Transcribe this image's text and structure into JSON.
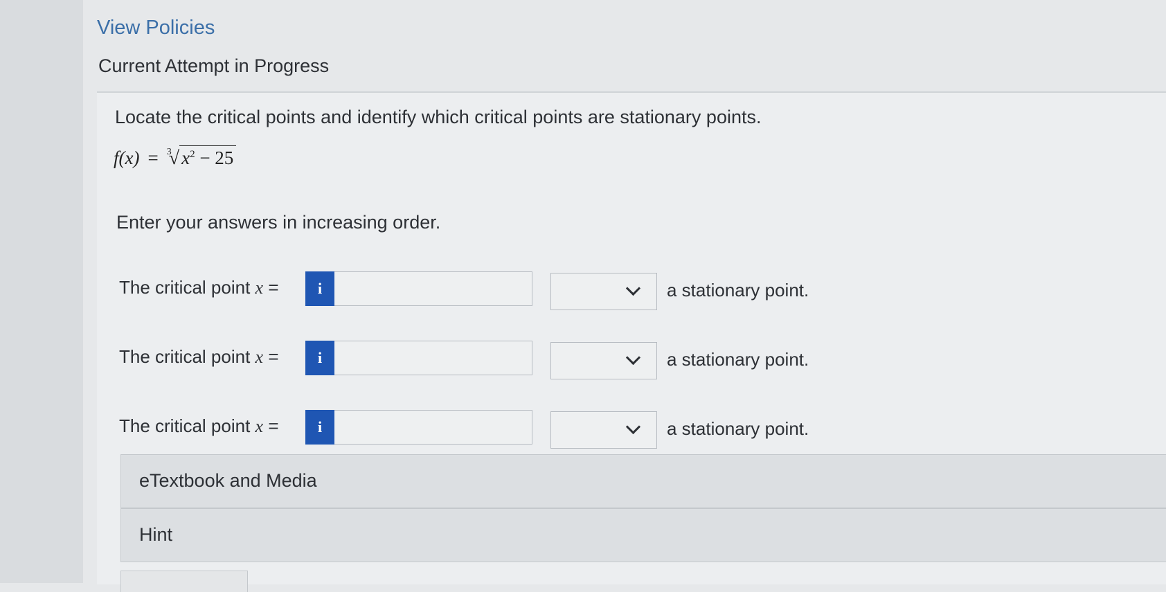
{
  "header": {
    "view_policies": "View Policies",
    "attempt_title": "Current Attempt in Progress"
  },
  "question": {
    "prompt": "Locate the critical points and identify which critical points are stationary points.",
    "formula": {
      "lhs": "f(x)",
      "equals": "=",
      "root_index": "3",
      "radicand_var": "x",
      "radicand_exp": "2",
      "radicand_rest": " − 25"
    },
    "instruction": "Enter your answers in increasing order."
  },
  "answers": {
    "rows": [
      {
        "label": "The critical point",
        "var": "x",
        "eq": " =",
        "info": "i",
        "value": "",
        "select_value": "",
        "suffix": "a stationary point."
      },
      {
        "label": "The critical point",
        "var": "x",
        "eq": " =",
        "info": "i",
        "value": "",
        "select_value": "",
        "suffix": "a stationary point."
      },
      {
        "label": "The critical point",
        "var": "x",
        "eq": " =",
        "info": "i",
        "value": "",
        "select_value": "",
        "suffix": "a stationary point."
      }
    ]
  },
  "resources": {
    "etextbook": "eTextbook and Media",
    "hint": "Hint"
  },
  "colors": {
    "info_button": "#1f56b3",
    "link": "#3b6fa8",
    "background": "#e6e8ea"
  },
  "icons": {
    "info": "info-icon",
    "dropdown": "chevron-down-icon"
  }
}
